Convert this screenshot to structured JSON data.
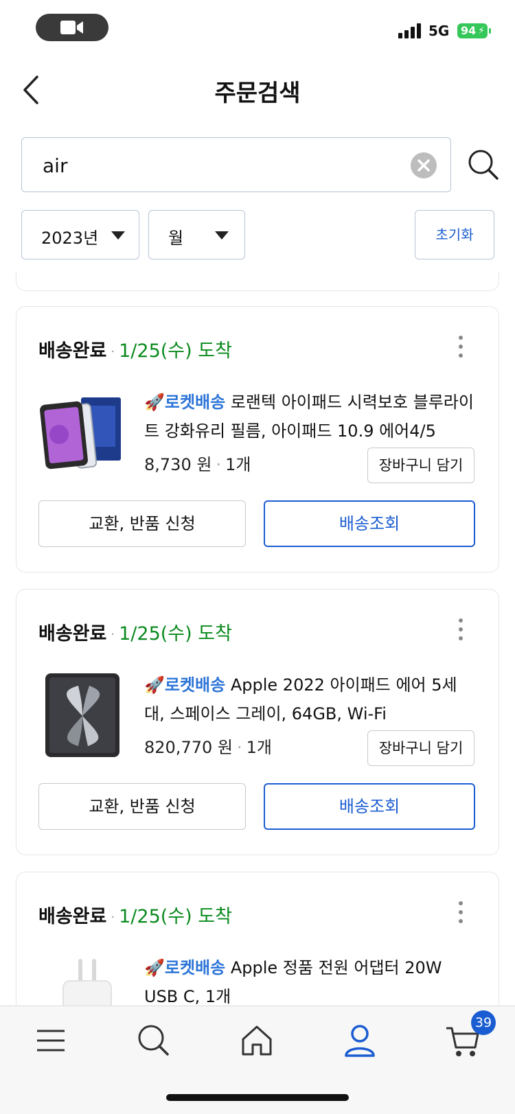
{
  "status_bar": {
    "network": "5G",
    "battery": "94"
  },
  "header": {
    "title": "주문검색"
  },
  "search": {
    "value": "air"
  },
  "filters": {
    "year": "2023년",
    "month": "월",
    "reset_label": "초기화"
  },
  "orders": [
    {
      "status": "배송완료",
      "arrival": "1/25(수) 도착",
      "badge": "🚀로켓배송",
      "name": "로랜텍 아이패드 시력보호 블루라이트 강화유리 필름, 아이패드 10.9 에어4/5",
      "price": "8,730 원",
      "qty": "1개",
      "cart_label": "장바구니 담기",
      "exchange_label": "교환, 반품 신청",
      "track_label": "배송조회"
    },
    {
      "status": "배송완료",
      "arrival": "1/25(수) 도착",
      "badge": "🚀로켓배송",
      "name": "Apple 2022 아이패드 에어 5세대, 스페이스 그레이, 64GB, Wi-Fi",
      "price": "820,770 원",
      "qty": "1개",
      "cart_label": "장바구니 담기",
      "exchange_label": "교환, 반품 신청",
      "track_label": "배송조회"
    },
    {
      "status": "배송완료",
      "arrival": "1/25(수) 도착",
      "badge": "🚀로켓배송",
      "name": "Apple 정품 전원 어댑터 20W USB C, 1개"
    }
  ],
  "bottom_nav": {
    "cart_count": "39"
  },
  "colors": {
    "accent": "#1a5cd1",
    "arrival": "#0a8a1e",
    "rocket": "#2d75d8",
    "battery": "#34c759"
  }
}
